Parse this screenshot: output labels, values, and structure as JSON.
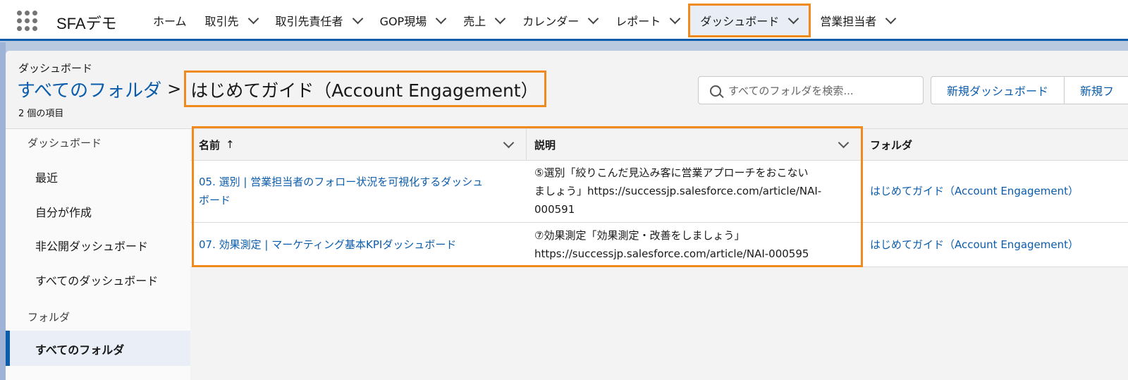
{
  "app": {
    "name": "SFAデモ"
  },
  "nav": {
    "items": [
      {
        "label": "ホーム",
        "has_menu": false
      },
      {
        "label": "取引先",
        "has_menu": true
      },
      {
        "label": "取引先責任者",
        "has_menu": true
      },
      {
        "label": "GOP現場",
        "has_menu": true
      },
      {
        "label": "売上",
        "has_menu": true
      },
      {
        "label": "カレンダー",
        "has_menu": true
      },
      {
        "label": "レポート",
        "has_menu": true
      },
      {
        "label": "ダッシュボード",
        "has_menu": true,
        "active": true
      },
      {
        "label": "営業担当者",
        "has_menu": true
      }
    ]
  },
  "header": {
    "object_label": "ダッシュボード",
    "breadcrumb_parent": "すべてのフォルダ",
    "breadcrumb_separator": ">",
    "title": "はじめてガイド（Account Engagement）",
    "item_count": "2 個の項目"
  },
  "search": {
    "placeholder": "すべてのフォルダを検索..."
  },
  "buttons": {
    "new_dashboard": "新規ダッシュボード",
    "new_folder": "新規フ"
  },
  "sidebar": {
    "dashboards_heading": "ダッシュボード",
    "dashboard_items": [
      "最近",
      "自分が作成",
      "非公開ダッシュボード",
      "すべてのダッシュボード"
    ],
    "folders_heading": "フォルダ",
    "selected_item": "すべてのフォルダ"
  },
  "table": {
    "columns": {
      "name": "名前",
      "name_sort": "↑",
      "description": "説明",
      "folder": "フォルダ"
    },
    "rows": [
      {
        "name_line1": "05. 選別 | 営業担当者のフォロー状況を可視化するダッシュ",
        "name_line2": "ボード",
        "desc_line1": "⑤選別「絞りこんだ見込み客に営業アプローチをおこない",
        "desc_line2": "ましょう」https://successjp.salesforce.com/article/NAI-",
        "desc_line3": "000591",
        "folder": "はじめてガイド（Account Engagement）"
      },
      {
        "name_line1": "07. 効果測定 | マーケティング基本KPIダッシュボード",
        "desc_line1": "⑦効果測定「効果測定・改善をしましょう」",
        "desc_line2": "https://successjp.salesforce.com/article/NAI-000595",
        "folder": "はじめてガイド（Account Engagement）"
      }
    ]
  },
  "colors": {
    "link": "#0b5cab",
    "highlight": "#f08a1c",
    "nav_border": "#0b5cab"
  }
}
